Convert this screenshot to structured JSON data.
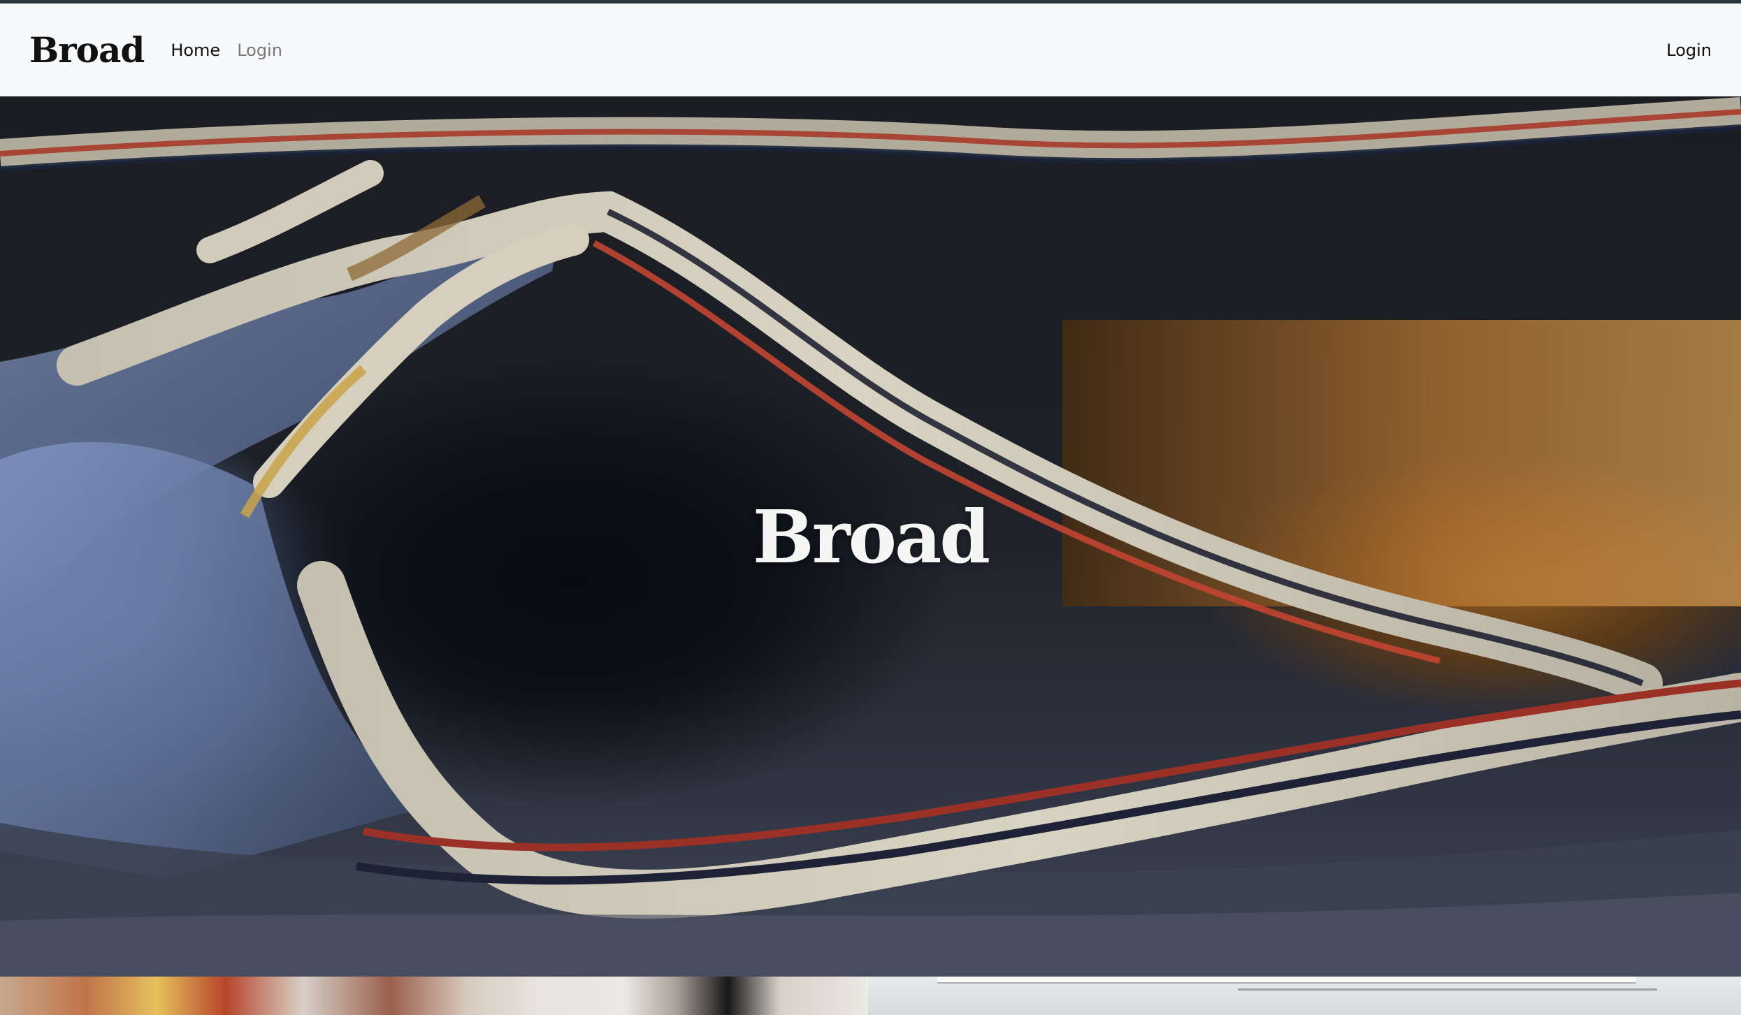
{
  "navbar": {
    "brand": "Broad",
    "links": [
      {
        "label": "Home",
        "active": true
      },
      {
        "label": "Login",
        "active": false
      }
    ],
    "right_link": "Login",
    "accent": "#26383a",
    "background": "#f8f9fb"
  },
  "hero": {
    "title": "Broad"
  },
  "tiles": [
    {
      "name": "bottom-left-image"
    },
    {
      "name": "bottom-right-image"
    }
  ]
}
